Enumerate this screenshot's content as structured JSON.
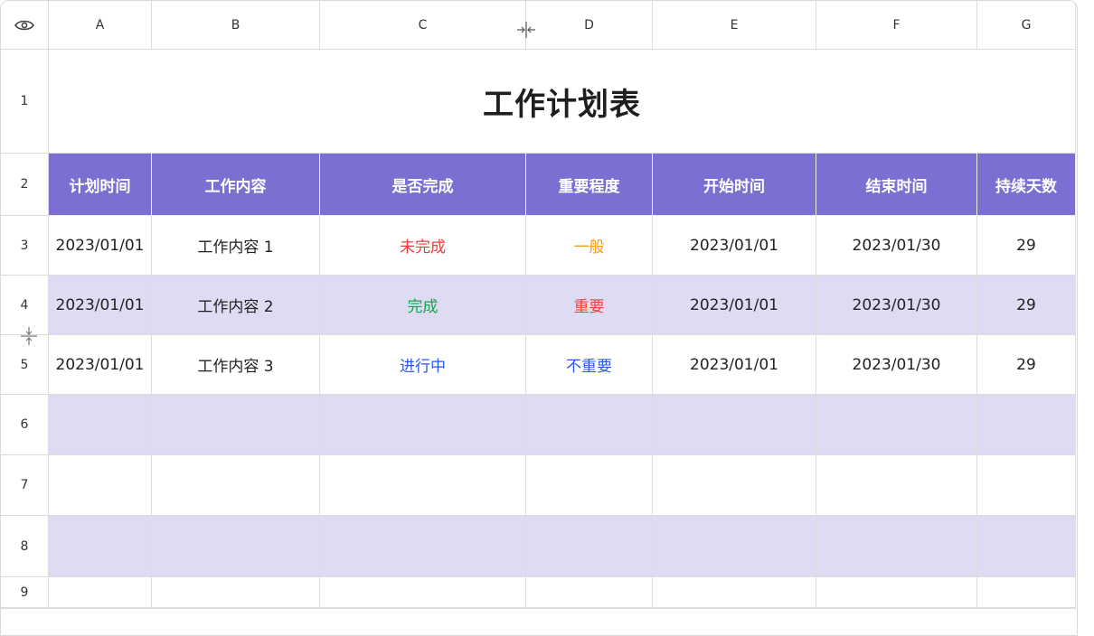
{
  "columns": [
    "A",
    "B",
    "C",
    "D",
    "E",
    "F",
    "G"
  ],
  "rows": [
    "1",
    "2",
    "3",
    "4",
    "5",
    "6",
    "7",
    "8",
    "9"
  ],
  "title": "工作计划表",
  "headers": [
    "计划时间",
    "工作内容",
    "是否完成",
    "重要程度",
    "开始时间",
    "结束时间",
    "持续天数"
  ],
  "data": [
    [
      "2023/01/01",
      "工作内容 1",
      "未完成",
      "一般",
      "2023/01/01",
      "2023/01/30",
      "29"
    ],
    [
      "2023/01/01",
      "工作内容 2",
      "完成",
      "重要",
      "2023/01/01",
      "2023/01/30",
      "29"
    ],
    [
      "2023/01/01",
      "工作内容 3",
      "进行中",
      "不重要",
      "2023/01/01",
      "2023/01/30",
      "29"
    ]
  ],
  "colors": {
    "header_bg": "#7b6fd1",
    "alt_row_bg": "#dedbf2",
    "status_unfinished": "#ef3b3b",
    "status_done": "#17a251",
    "status_in_progress": "#2a58e8",
    "importance_normal": "#f29b1d",
    "importance_high": "#ef3b3b",
    "importance_low": "#2a58e8"
  },
  "icons": {
    "corner": "eye-icon",
    "column_resize": "column-resize-icon",
    "row_resize": "row-resize-icon"
  }
}
